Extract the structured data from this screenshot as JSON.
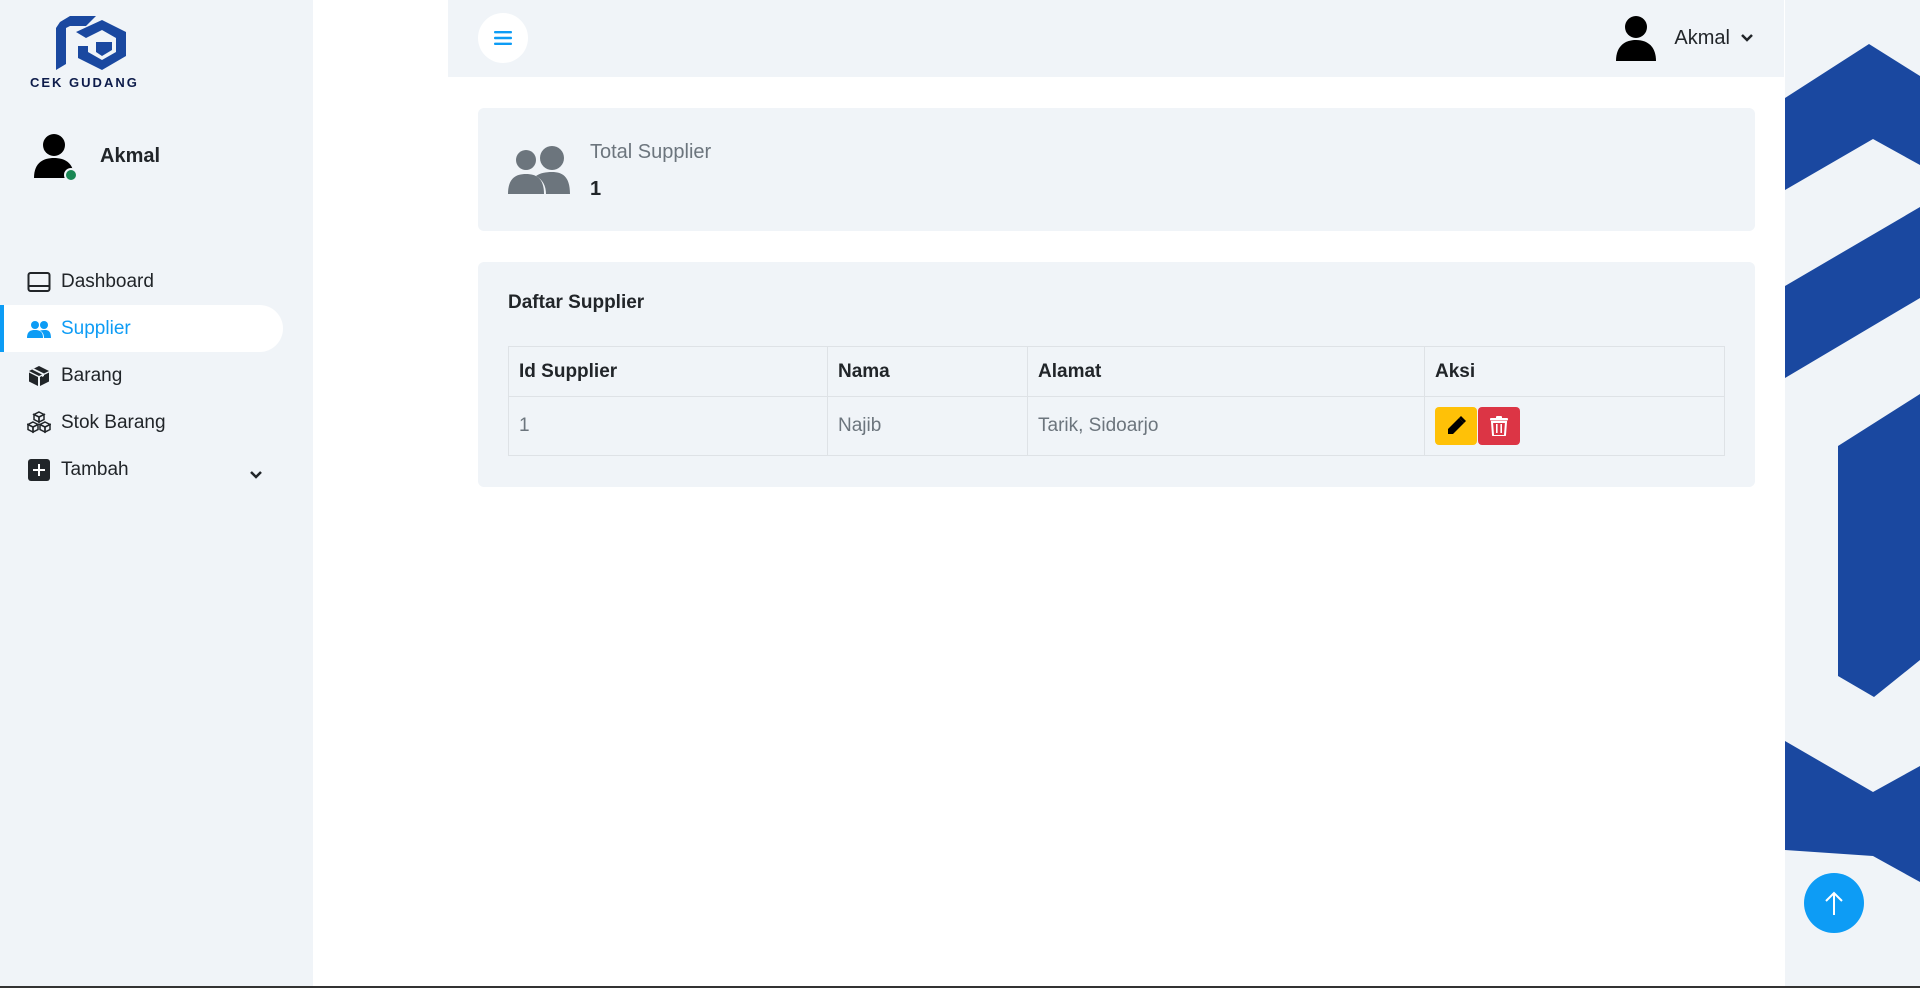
{
  "brand": {
    "logo_text": "CEK GUDANG",
    "accent": "#0d9cf5",
    "logo_blue": "#1a48a0"
  },
  "profile": {
    "name": "Akmal",
    "status": "online"
  },
  "sidebar": {
    "items": [
      {
        "label": "Dashboard",
        "icon": "dashboard-icon",
        "active": false
      },
      {
        "label": "Supplier",
        "icon": "users-icon",
        "active": true
      },
      {
        "label": "Barang",
        "icon": "box-icon",
        "active": false
      },
      {
        "label": "Stok Barang",
        "icon": "boxes-icon",
        "active": false
      },
      {
        "label": "Tambah",
        "icon": "plus-square-icon",
        "active": false,
        "expandable": true
      }
    ]
  },
  "topbar": {
    "user_name": "Akmal"
  },
  "summary": {
    "label": "Total Supplier",
    "value": "1"
  },
  "supplier_list": {
    "title": "Daftar Supplier",
    "columns": [
      "Id Supplier",
      "Nama",
      "Alamat",
      "Aksi"
    ],
    "rows": [
      {
        "id": "1",
        "nama": "Najib",
        "alamat": "Tarik, Sidoarjo"
      }
    ]
  },
  "colors": {
    "edit_button": "#ffc107",
    "delete_button": "#dc3545"
  }
}
